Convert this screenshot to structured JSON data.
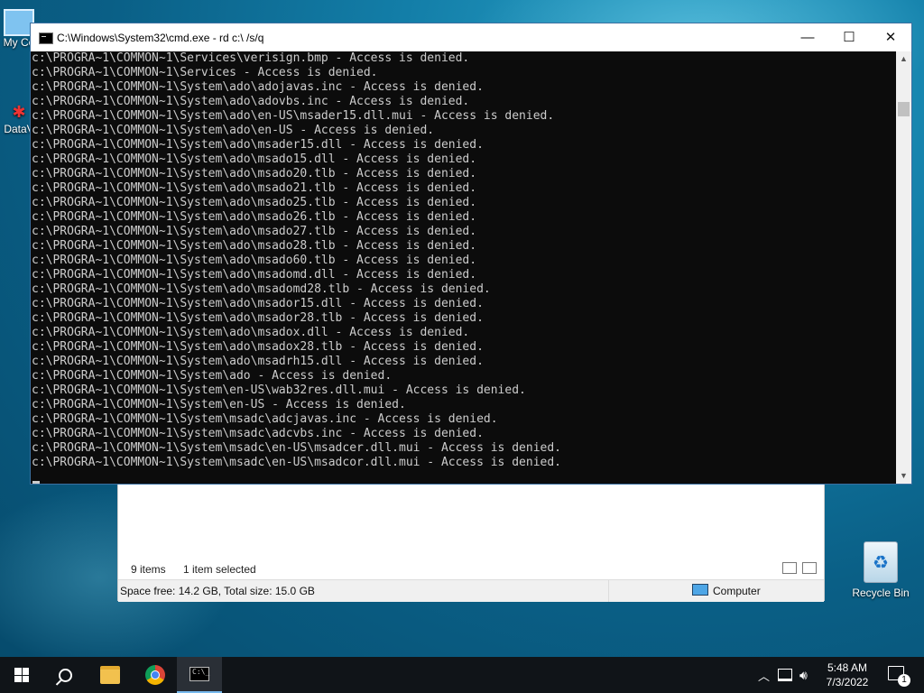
{
  "desktop": {
    "icons": [
      {
        "label": "My Co"
      },
      {
        "label": "DataV"
      },
      {
        "label": "Recycle Bin"
      }
    ]
  },
  "explorer": {
    "items_count": "9 items",
    "selection": "1 item selected",
    "space": "Space free: 14.2 GB, Total size: 15.0 GB",
    "location": "Computer"
  },
  "cmd": {
    "title": "C:\\Windows\\System32\\cmd.exe - rd  c:\\ /s/q",
    "lines": [
      "c:\\PROGRA~1\\COMMON~1\\Services\\verisign.bmp - Access is denied.",
      "c:\\PROGRA~1\\COMMON~1\\Services - Access is denied.",
      "c:\\PROGRA~1\\COMMON~1\\System\\ado\\adojavas.inc - Access is denied.",
      "c:\\PROGRA~1\\COMMON~1\\System\\ado\\adovbs.inc - Access is denied.",
      "c:\\PROGRA~1\\COMMON~1\\System\\ado\\en-US\\msader15.dll.mui - Access is denied.",
      "c:\\PROGRA~1\\COMMON~1\\System\\ado\\en-US - Access is denied.",
      "c:\\PROGRA~1\\COMMON~1\\System\\ado\\msader15.dll - Access is denied.",
      "c:\\PROGRA~1\\COMMON~1\\System\\ado\\msado15.dll - Access is denied.",
      "c:\\PROGRA~1\\COMMON~1\\System\\ado\\msado20.tlb - Access is denied.",
      "c:\\PROGRA~1\\COMMON~1\\System\\ado\\msado21.tlb - Access is denied.",
      "c:\\PROGRA~1\\COMMON~1\\System\\ado\\msado25.tlb - Access is denied.",
      "c:\\PROGRA~1\\COMMON~1\\System\\ado\\msado26.tlb - Access is denied.",
      "c:\\PROGRA~1\\COMMON~1\\System\\ado\\msado27.tlb - Access is denied.",
      "c:\\PROGRA~1\\COMMON~1\\System\\ado\\msado28.tlb - Access is denied.",
      "c:\\PROGRA~1\\COMMON~1\\System\\ado\\msado60.tlb - Access is denied.",
      "c:\\PROGRA~1\\COMMON~1\\System\\ado\\msadomd.dll - Access is denied.",
      "c:\\PROGRA~1\\COMMON~1\\System\\ado\\msadomd28.tlb - Access is denied.",
      "c:\\PROGRA~1\\COMMON~1\\System\\ado\\msador15.dll - Access is denied.",
      "c:\\PROGRA~1\\COMMON~1\\System\\ado\\msador28.tlb - Access is denied.",
      "c:\\PROGRA~1\\COMMON~1\\System\\ado\\msadox.dll - Access is denied.",
      "c:\\PROGRA~1\\COMMON~1\\System\\ado\\msadox28.tlb - Access is denied.",
      "c:\\PROGRA~1\\COMMON~1\\System\\ado\\msadrh15.dll - Access is denied.",
      "c:\\PROGRA~1\\COMMON~1\\System\\ado - Access is denied.",
      "c:\\PROGRA~1\\COMMON~1\\System\\en-US\\wab32res.dll.mui - Access is denied.",
      "c:\\PROGRA~1\\COMMON~1\\System\\en-US - Access is denied.",
      "c:\\PROGRA~1\\COMMON~1\\System\\msadc\\adcjavas.inc - Access is denied.",
      "c:\\PROGRA~1\\COMMON~1\\System\\msadc\\adcvbs.inc - Access is denied.",
      "c:\\PROGRA~1\\COMMON~1\\System\\msadc\\en-US\\msadcer.dll.mui - Access is denied.",
      "c:\\PROGRA~1\\COMMON~1\\System\\msadc\\en-US\\msadcor.dll.mui - Access is denied."
    ],
    "buttons": {
      "minimize": "—",
      "maximize": "☐",
      "close": "✕"
    }
  },
  "taskbar": {
    "time": "5:48 AM",
    "date": "7/3/2022",
    "notification_count": "1",
    "icons": [
      "windows-start-icon",
      "search-icon",
      "file-explorer-icon",
      "chrome-icon",
      "command-prompt-icon"
    ]
  }
}
